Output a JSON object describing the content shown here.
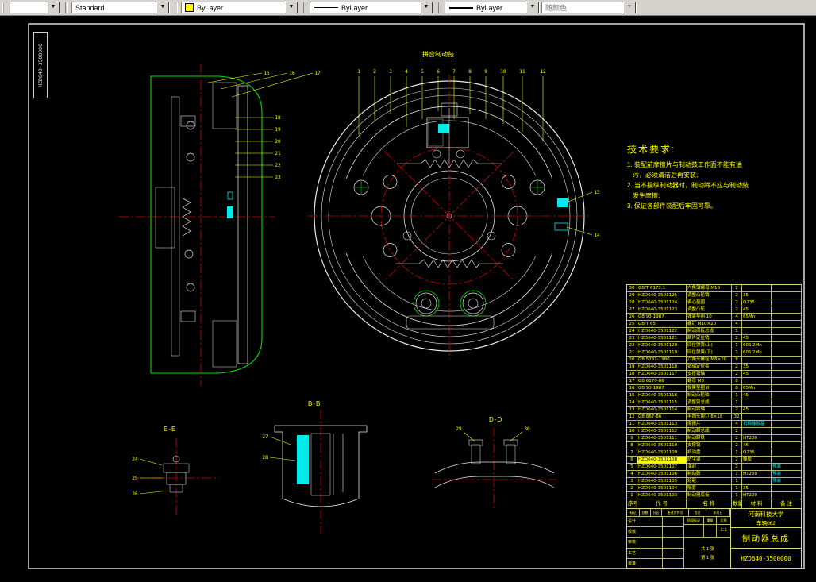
{
  "toolbar": {
    "dim_combo": "",
    "style_combo": "Standard",
    "color_combo": "ByLayer",
    "linetype_combo": "ByLayer",
    "lineweight_combo": "ByLayer",
    "plotstyle_combo": "随颜色"
  },
  "sheet": {
    "corner_label": "HZD640-3500000",
    "drum_label": "拼合制动鼓",
    "section_ee": "E-E",
    "section_bb": "B-B",
    "section_dd": "D-D"
  },
  "tech": {
    "title": "技术要求:",
    "lines": [
      "1. 装配前摩擦片与制动鼓工作面不能有油",
      "污，必须清洁后再安装;",
      "2. 当不操纵制动器时，制动蹄不应与制动鼓",
      "发生摩擦;",
      "3. 保证各部件装配后牢固可靠。"
    ]
  },
  "callouts": {
    "center": [
      "1",
      "2",
      "3",
      "4",
      "5",
      "6",
      "7",
      "8",
      "9",
      "10",
      "11",
      "12"
    ],
    "right": [
      "13",
      "14"
    ],
    "left_top": [
      "15",
      "16",
      "17"
    ],
    "left": [
      "18",
      "19",
      "20",
      "21",
      "22",
      "23"
    ],
    "ee": [
      "24",
      "25",
      "26"
    ],
    "bb": [
      "27",
      "28"
    ],
    "dd": [
      "29",
      "30"
    ]
  },
  "bom": {
    "headers": [
      "序号",
      "代  号",
      "名  称",
      "数量",
      "材  料",
      "备 注"
    ],
    "rows": [
      {
        "no": "30",
        "code": "GB/T 6172.1",
        "name": "六角薄螺母 M10",
        "qty": "2",
        "mat": "",
        "remark": ""
      },
      {
        "no": "29",
        "code": "HZD640-3501125",
        "name": "调整凸轮销",
        "qty": "2",
        "mat": "35",
        "remark": ""
      },
      {
        "no": "28",
        "code": "HZD640-3501124",
        "name": "偏心垫圈",
        "qty": "2",
        "mat": "Q235",
        "remark": ""
      },
      {
        "no": "27",
        "code": "HZD640-3501123",
        "name": "调整凸轮",
        "qty": "2",
        "mat": "45",
        "remark": ""
      },
      {
        "no": "26",
        "code": "GB 93-1987",
        "name": "弹簧垫圈 10",
        "qty": "4",
        "mat": "65Mn",
        "remark": ""
      },
      {
        "no": "25",
        "code": "GB/T 65",
        "name": "螺钉 M10×20",
        "qty": "4",
        "mat": "",
        "remark": ""
      },
      {
        "no": "24",
        "code": "HZD640-3501122",
        "name": "制动底板总成",
        "qty": "1",
        "mat": "",
        "remark": ""
      },
      {
        "no": "23",
        "code": "HZD640-3501121",
        "name": "蹄片定位销",
        "qty": "2",
        "mat": "45",
        "remark": ""
      },
      {
        "no": "22",
        "code": "HZD640-3501120",
        "name": "回位弹簧(上)",
        "qty": "1",
        "mat": "60Si2Mn",
        "remark": ""
      },
      {
        "no": "21",
        "code": "HZD640-3501119",
        "name": "回位弹簧(下)",
        "qty": "1",
        "mat": "60Si2Mn",
        "remark": ""
      },
      {
        "no": "20",
        "code": "GB 5781-1986",
        "name": "六角头螺栓 M8×20",
        "qty": "8",
        "mat": "",
        "remark": ""
      },
      {
        "no": "19",
        "code": "HZD640-3501118",
        "name": "销轴定位套",
        "qty": "2",
        "mat": "35",
        "remark": ""
      },
      {
        "no": "18",
        "code": "HZD640-3501117",
        "name": "支撑销轴",
        "qty": "2",
        "mat": "45",
        "remark": ""
      },
      {
        "no": "17",
        "code": "GB 6170-86",
        "name": "螺母 M8",
        "qty": "8",
        "mat": "",
        "remark": ""
      },
      {
        "no": "16",
        "code": "GB 93-1987",
        "name": "弹簧垫圈 8",
        "qty": "8",
        "mat": "65Mn",
        "remark": ""
      },
      {
        "no": "15",
        "code": "HZD640-3501116",
        "name": "制动凸轮轴",
        "qty": "1",
        "mat": "45",
        "remark": ""
      },
      {
        "no": "14",
        "code": "HZD640-3501115",
        "name": "调整臂总成",
        "qty": "1",
        "mat": "",
        "remark": ""
      },
      {
        "no": "13",
        "code": "HZD640-3501114",
        "name": "制动蹄轴",
        "qty": "2",
        "mat": "45",
        "remark": ""
      },
      {
        "no": "12",
        "code": "GB 867-86",
        "name": "半圆头铆钉 8×18",
        "qty": "32",
        "mat": "",
        "remark": ""
      },
      {
        "no": "11",
        "code": "HZD640-3501113",
        "name": "摩擦片",
        "qty": "4",
        "mat": "石棉橡胶基",
        "mat_cyan": true,
        "remark": ""
      },
      {
        "no": "10",
        "code": "HZD640-3501112",
        "name": "制动蹄总成",
        "qty": "2",
        "mat": "",
        "remark": ""
      },
      {
        "no": "9",
        "code": "HZD640-3501111",
        "name": "制动蹄铁",
        "qty": "2",
        "mat": "HT200",
        "remark": ""
      },
      {
        "no": "8",
        "code": "HZD640-3501110",
        "name": "支撑销",
        "qty": "2",
        "mat": "45",
        "remark": ""
      },
      {
        "no": "7",
        "code": "HZD640-3501109",
        "name": "挡油盘",
        "qty": "1",
        "mat": "Q235",
        "remark": ""
      },
      {
        "no": "6",
        "code": "HZD640-3501108",
        "name": "防尘罩",
        "qty": "2",
        "mat": "橡胶",
        "remark": "",
        "fill": true
      },
      {
        "no": "5",
        "code": "HZD640-3501107",
        "name": "油封",
        "qty": "1",
        "mat": "",
        "remark": "预装",
        "remark_cyan": true
      },
      {
        "no": "4",
        "code": "HZD640-3501106",
        "name": "制动鼓",
        "qty": "1",
        "mat": "HT250",
        "remark": "预装",
        "remark_cyan": true
      },
      {
        "no": "3",
        "code": "HZD640-3501105",
        "name": "轮毂",
        "qty": "1",
        "mat": "",
        "remark": "预装",
        "remark_cyan": true
      },
      {
        "no": "2",
        "code": "HZD640-3501104",
        "name": "隔套",
        "qty": "1",
        "mat": "35",
        "remark": ""
      },
      {
        "no": "1",
        "code": "HZD640-3501103",
        "name": "制动器底板",
        "qty": "1",
        "mat": "HT200",
        "remark": ""
      }
    ]
  },
  "title_block": {
    "strip": [
      "标记",
      "处数",
      "分区",
      "更改文件号",
      "签名",
      "年月日"
    ],
    "sign_rows": [
      "设计",
      "校核",
      "审核",
      "工艺",
      "批准"
    ],
    "stage_labels": [
      "阶段标记",
      "重量",
      "比例"
    ],
    "scale": "1:1",
    "sheet_count": "共 1 张",
    "sheet_index": "第 1 张",
    "org": "河南科技大学",
    "class_name": "车辆062",
    "title": "制动器总成",
    "drawing_no": "HZD640-3500000"
  }
}
